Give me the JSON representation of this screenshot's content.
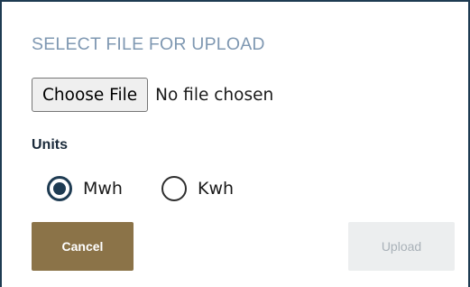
{
  "dialog": {
    "title": "SELECT FILE FOR UPLOAD",
    "file_input": {
      "button_label": "Choose File",
      "status_text": "No file chosen"
    },
    "units": {
      "label": "Units",
      "options": [
        {
          "label": "Mwh",
          "selected": true
        },
        {
          "label": "Kwh",
          "selected": false
        }
      ]
    },
    "actions": {
      "cancel_label": "Cancel",
      "upload_label": "Upload",
      "upload_disabled": true
    }
  },
  "colors": {
    "border": "#1e3b52",
    "title": "#7f98b2",
    "cancel_bg": "#8b7348",
    "upload_bg_disabled": "#eceeef",
    "radio_selected": "#1e3b52"
  }
}
